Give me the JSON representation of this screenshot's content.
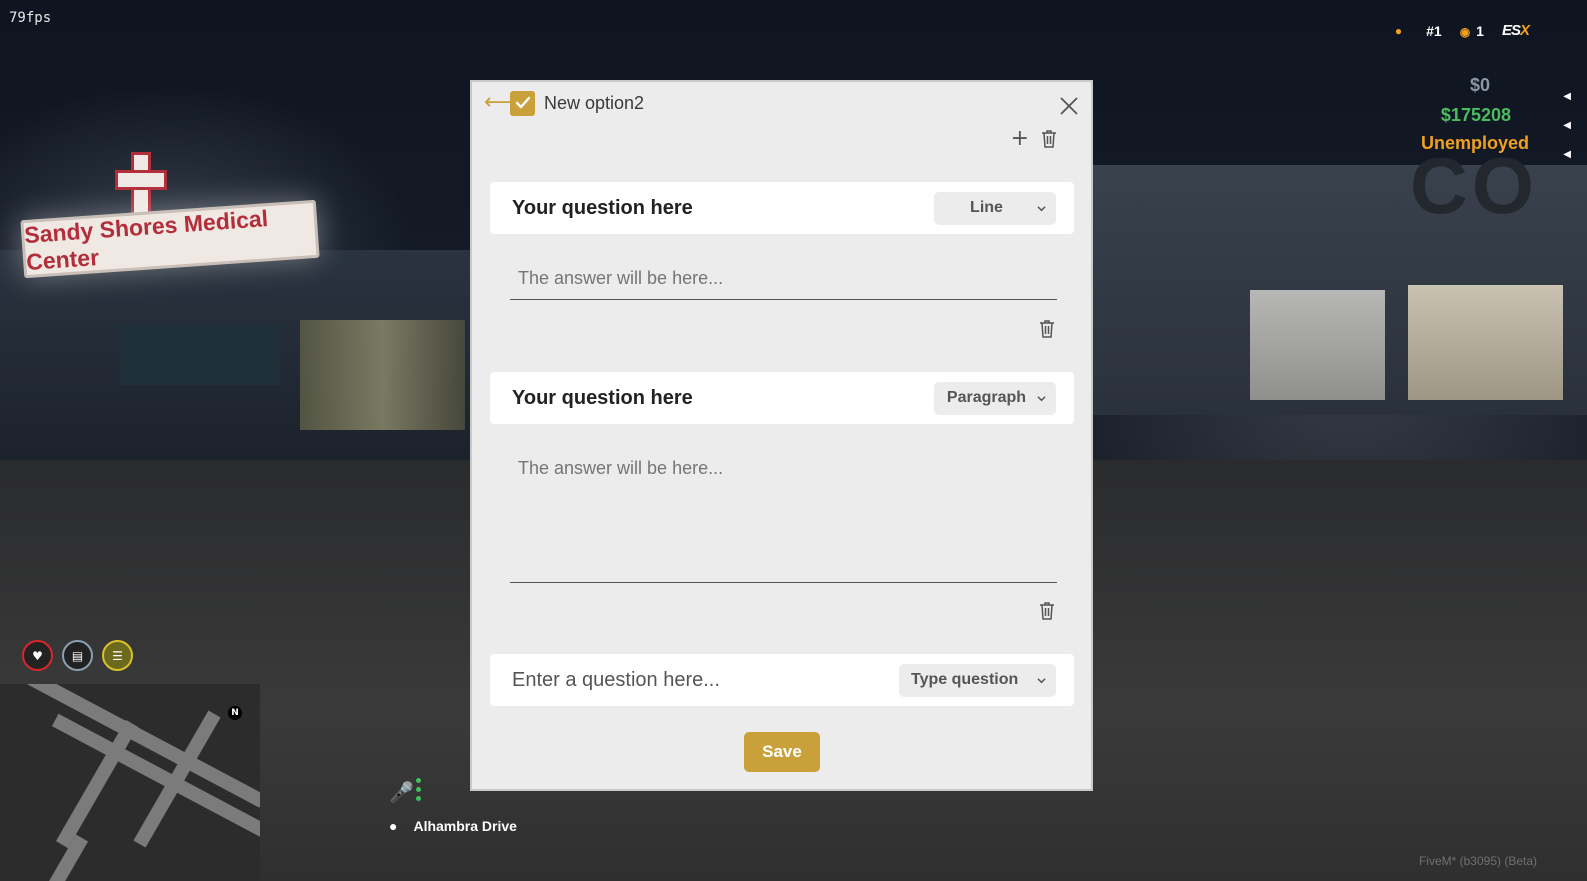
{
  "hud": {
    "fps": "79fps",
    "player_id": "#1",
    "online_count": "1",
    "brand": "ES",
    "brand_accent": "X",
    "cash": "$0",
    "bank": "$175208",
    "job": "Unemployed",
    "north": "N",
    "street": "Alhambra Drive",
    "client_version": "FiveM* (b3095) (Beta)"
  },
  "background": {
    "sign_text": "Sandy Shores Medical Center"
  },
  "colors": {
    "accent": "#c9a13a",
    "bank_green": "#4cbb5f",
    "job_orange": "#f0a020",
    "modal_bg": "#ececec"
  },
  "form": {
    "title": "New option2",
    "checked": true,
    "questions": [
      {
        "title": "Your question here",
        "type": "Line",
        "answer_placeholder": "The answer will be here..."
      },
      {
        "title": "Your question here",
        "type": "Paragraph",
        "answer_placeholder": "The answer will be here..."
      }
    ],
    "new_question": {
      "placeholder": "Enter a question here...",
      "type_placeholder": "Type question"
    },
    "save_label": "Save"
  },
  "icons": [
    "back-arrow-icon",
    "checkmark-icon",
    "close-icon",
    "plus-icon",
    "trash-icon",
    "chevron-down-icon",
    "microphone-icon",
    "location-pin-icon",
    "heart-icon",
    "food-icon",
    "drink-icon",
    "person-icon",
    "coin-icon"
  ]
}
